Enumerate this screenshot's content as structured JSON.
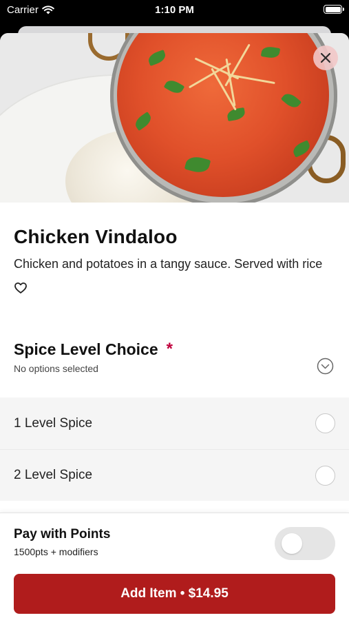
{
  "status_bar": {
    "carrier": "Carrier",
    "time": "1:10 PM"
  },
  "item": {
    "title": "Chicken Vindaloo",
    "description": "Chicken and potatoes in a tangy sauce. Served with rice"
  },
  "modifier_group": {
    "title": "Spice Level Choice",
    "required_mark": "*",
    "status": "No options selected",
    "options": [
      {
        "label": "1 Level Spice",
        "selected": false
      },
      {
        "label": "2 Level Spice",
        "selected": false
      }
    ]
  },
  "points": {
    "title": "Pay with Points",
    "subtitle": "1500pts + modifiers",
    "enabled": false
  },
  "add_button": {
    "label": "Add Item • $14.95"
  },
  "colors": {
    "accent": "#b01c1c",
    "required": "#c0003c",
    "close_bg": "#f2c8c8"
  },
  "icons": [
    "wifi-icon",
    "battery-icon",
    "close-icon",
    "heart-icon",
    "chevron-down-circle-icon"
  ]
}
